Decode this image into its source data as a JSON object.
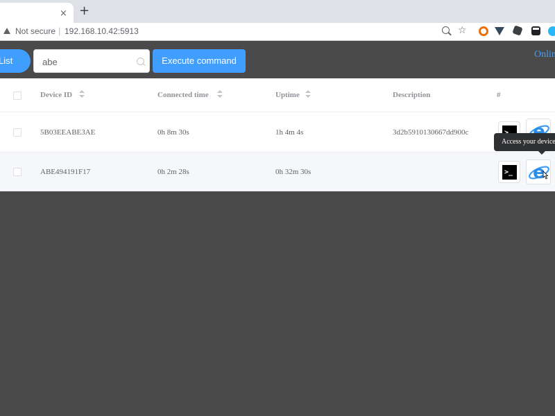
{
  "browser": {
    "tab_close": "×",
    "new_tab": "+",
    "security_label": "Not secure",
    "url_separator": "|",
    "url": "192.168.10.42:5913",
    "star_glyph": "☆",
    "extensions": [
      "orange-ring-icon",
      "vue-devtools-icon",
      "extension-cube-icon",
      "toolbar-extension-icon",
      "teal-circle-icon"
    ]
  },
  "toolbar": {
    "list_label": "List",
    "search": {
      "value": "abe",
      "placeholder": ""
    },
    "execute_label": "Execute command",
    "online_label": "Onlin"
  },
  "table": {
    "columns": [
      "Device ID",
      "Connected time",
      "Uptime",
      "Description",
      "#"
    ],
    "rows": [
      {
        "device_id": "5B03EEABE3AE",
        "connected": "0h 8m 30s",
        "uptime": "1h 4m 4s",
        "description": "3d2b5910130667dd900c"
      },
      {
        "device_id": "ABE494191F17",
        "connected": "0h 2m 28s",
        "uptime": "0h 32m 30s",
        "description": ""
      }
    ],
    "terminal_glyph": ">_",
    "tooltip": "Access your device"
  },
  "colors": {
    "accent": "#409eff",
    "background": "#4a4a4a",
    "tooltip": "#303133"
  }
}
